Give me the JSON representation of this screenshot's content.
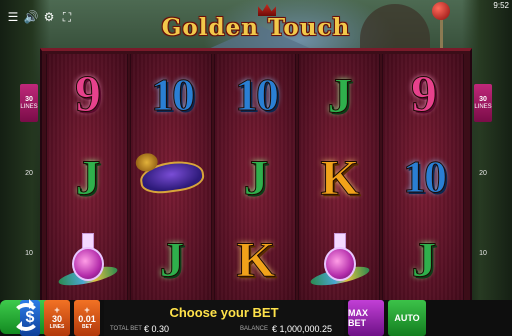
{
  "status": {
    "clock": "9:52"
  },
  "game": {
    "title": "Golden Touch"
  },
  "lines_markers": {
    "left": [
      {
        "value": "30",
        "label": "LINES"
      },
      {
        "value": "20",
        "label": ""
      },
      {
        "value": "10",
        "label": ""
      }
    ],
    "right": [
      {
        "value": "30",
        "label": "LINES"
      },
      {
        "value": "20",
        "label": ""
      },
      {
        "value": "10",
        "label": ""
      }
    ]
  },
  "reels": [
    [
      "9",
      "J",
      "potion"
    ],
    [
      "10",
      "mask",
      "J"
    ],
    [
      "10",
      "J",
      "K"
    ],
    [
      "J",
      "K",
      "potion"
    ],
    [
      "9",
      "10",
      "J"
    ]
  ],
  "controls": {
    "currency_symbol": "$",
    "lines": {
      "plus": "+",
      "value": "30",
      "minus": "−",
      "label": "LINES"
    },
    "bet": {
      "plus": "+",
      "value": "0.01",
      "minus": "−",
      "label": "BET"
    },
    "message": "Choose your BET",
    "total_bet_label": "TOTAL BET",
    "total_bet_value": "€ 0.30",
    "balance_label": "BALANCE",
    "balance_value": "€ 1,000,000.25",
    "max_bet_label": "MAX BET",
    "auto_label": "AUTO"
  },
  "colors": {
    "reel_bg": "#5a1226",
    "spin_green": "#3ecb4c",
    "message_yellow": "#ffe24a",
    "stepper_orange": "#f27224"
  }
}
